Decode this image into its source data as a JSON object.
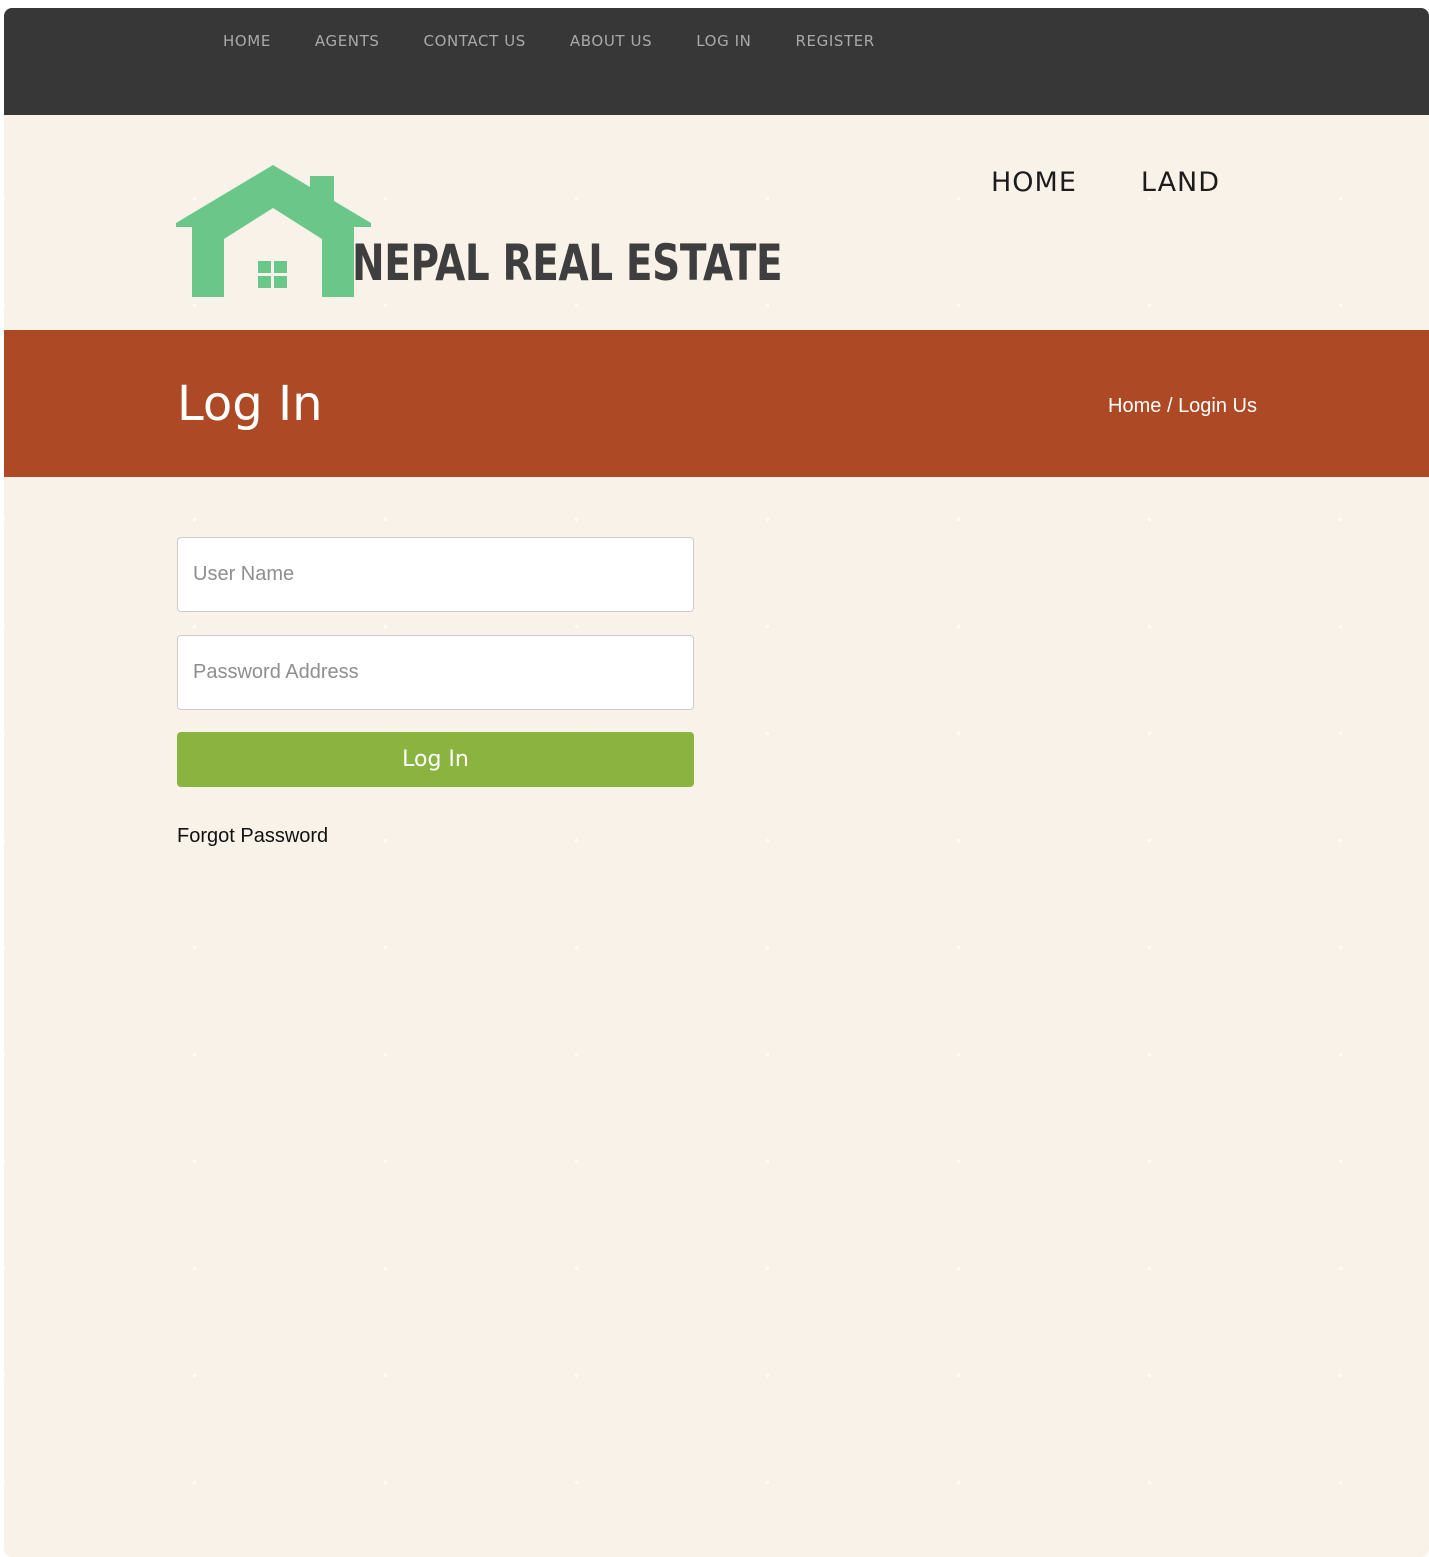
{
  "top_nav": {
    "items": [
      "HOME",
      "AGENTS",
      "CONTACT US",
      "ABOUT US",
      "LOG IN",
      "REGISTER"
    ]
  },
  "header": {
    "logo_text": "NEPAL REAL ESTATE",
    "nav": [
      "HOME",
      "LAND"
    ]
  },
  "page_title_band": {
    "title": "Log In",
    "breadcrumb": {
      "home": "Home",
      "separator": " / ",
      "current": "Login Us"
    }
  },
  "login_form": {
    "username_placeholder": "User Name",
    "username_value": "",
    "password_placeholder": "Password Address",
    "password_value": "",
    "submit_label": "Log In",
    "forgot_label": "Forgot Password"
  },
  "colors": {
    "topbar": "#383737",
    "page_background": "#f9f2e8",
    "title_band": "#ad4925",
    "login_button": "#8ab43f",
    "logo_house": "#6bc68a",
    "logo_text": "#3e3e3e"
  },
  "icons": {
    "logo": "house-icon"
  }
}
